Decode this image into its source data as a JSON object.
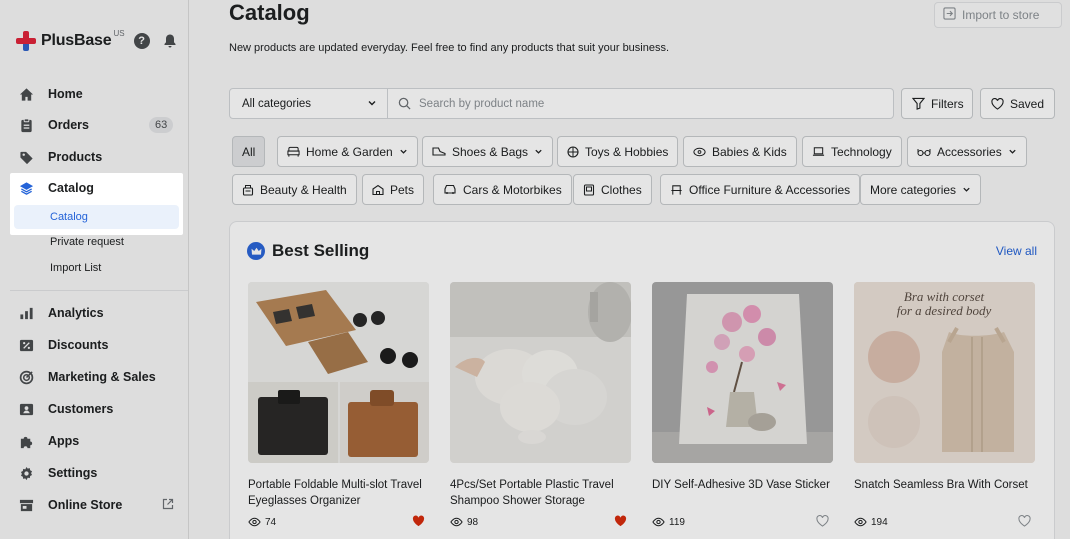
{
  "brand": {
    "name": "PlusBase",
    "region": "US",
    "help": "?"
  },
  "nav": {
    "home": "Home",
    "orders": "Orders",
    "orders_count": "63",
    "products": "Products",
    "catalog": "Catalog",
    "catalog_sub": "Catalog",
    "private_request": "Private request",
    "import_list": "Import List",
    "analytics": "Analytics",
    "discounts": "Discounts",
    "marketing": "Marketing & Sales",
    "customers": "Customers",
    "apps": "Apps",
    "settings": "Settings",
    "online_store": "Online Store"
  },
  "header": {
    "title": "Catalog",
    "subtitle": "New products are updated everyday. Feel free to find any products that suit your business.",
    "import_label": "Import to store"
  },
  "search": {
    "category_value": "All categories",
    "placeholder": "Search by product name",
    "filters_label": "Filters",
    "saved_label": "Saved"
  },
  "chips": {
    "all": "All",
    "home_garden": "Home & Garden",
    "shoes_bags": "Shoes & Bags",
    "toys_hobbies": "Toys & Hobbies",
    "babies_kids": "Babies & Kids",
    "technology": "Technology",
    "accessories": "Accessories",
    "beauty_health": "Beauty & Health",
    "pets": "Pets",
    "cars_motorbikes": "Cars & Motorbikes",
    "clothes": "Clothes",
    "office_furniture": "Office Furniture & Accessories",
    "more": "More categories"
  },
  "best_selling": {
    "title": "Best Selling",
    "view_all": "View all",
    "products": [
      {
        "title": "Portable Foldable Multi-slot Travel Eyeglasses Organizer",
        "views": "74",
        "saved": true
      },
      {
        "title": "4Pcs/Set Portable Plastic Travel Shampoo Shower Storage",
        "views": "98",
        "saved": true
      },
      {
        "title": "DIY Self-Adhesive 3D Vase Sticker",
        "views": "119",
        "saved": false
      },
      {
        "title": "Snatch Seamless Bra With Corset",
        "views": "194",
        "saved": false
      }
    ],
    "product4_image_text_1": "Bra with corset",
    "product4_image_text_2": "for a desired body"
  },
  "colors": {
    "accent": "#2463d8",
    "heart": "#d72c0d",
    "brand_red": "#e0243a"
  }
}
